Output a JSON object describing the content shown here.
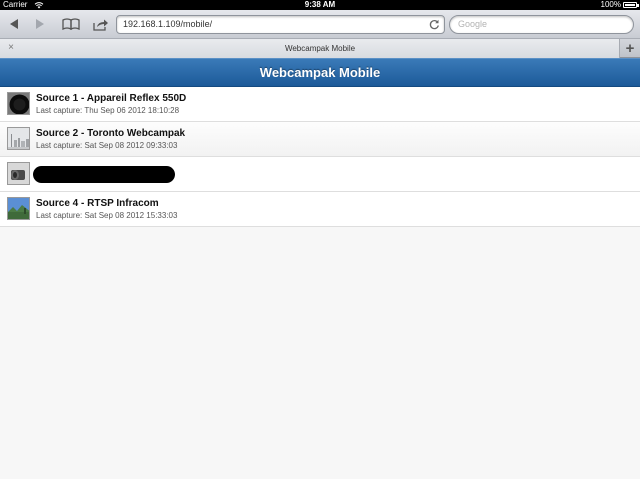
{
  "status_bar": {
    "carrier": "Carrier",
    "time": "9:38 AM",
    "battery": "100%"
  },
  "toolbar": {
    "url": "192.168.1.109/mobile/",
    "search_placeholder": "Google"
  },
  "tab": {
    "title": "Webcampak Mobile",
    "close_glyph": "×",
    "new_tab_glyph": "+"
  },
  "page": {
    "title": "Webcampak Mobile"
  },
  "sources": [
    {
      "title": "Source 1 - Appareil Reflex 550D",
      "subtitle": "Last capture: Thu Sep 06 2012 18:10:28",
      "thumb": "dark-camera-thumbnail"
    },
    {
      "title": "Source 2 - Toronto Webcampak",
      "subtitle": "Last capture: Sat Sep 08 2012 09:33:03",
      "thumb": "city-skyline-thumbnail"
    },
    {
      "title": "",
      "subtitle": "",
      "thumb": "camera-lens-thumbnail",
      "redacted": true
    },
    {
      "title": "Source 4 - RTSP Infracom",
      "subtitle": "Last capture: Sat Sep 08 2012 15:33:03",
      "thumb": "landscape-thumbnail"
    }
  ],
  "colors": {
    "header_blue": "#1c5a99",
    "background": "#f7f7f7"
  }
}
